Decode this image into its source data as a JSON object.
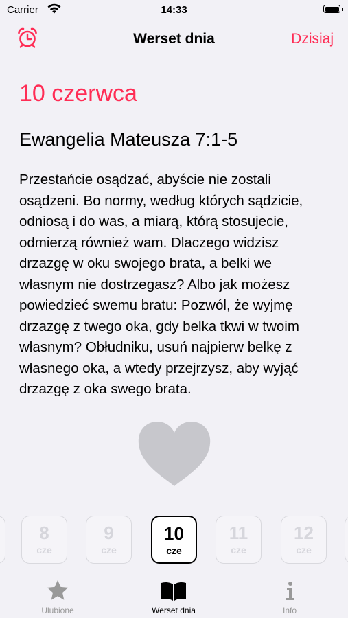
{
  "status_bar": {
    "carrier": "Carrier",
    "time": "14:33"
  },
  "nav": {
    "title": "Werset dnia",
    "today_label": "Dzisiaj",
    "alarm_icon": "alarm-clock-icon"
  },
  "accent_color": "#ff2d55",
  "content": {
    "date": "10 czerwca",
    "reference": "Ewangelia Mateusza 7:1-5",
    "verse_lines": [
      "Przestańcie osądzać, abyście nie zostali",
      "osądzeni. Bo normy, według których sądzicie,",
      "odniosą i do was, a miarą, którą stosujecie,",
      "odmierzą również wam. Dlaczego widzisz",
      "drzazgę w oku swojego brata, a belki we",
      "własnym nie dostrzegasz? Albo jak możesz",
      "powiedzieć swemu bratu: Pozwól, że wyjmę",
      "drzazgę z twego oka, gdy belka tkwi w twoim",
      "własnym? Obłudniku, usuń najpierw belkę z",
      "własnego oka, a wtedy przejrzysz, aby wyjąć",
      "drzazgę z oka swego brata."
    ],
    "favorite_icon": "heart-icon",
    "favorited": false
  },
  "days": [
    {
      "num": "8",
      "month": "cze"
    },
    {
      "num": "9",
      "month": "cze"
    },
    {
      "num": "10",
      "month": "cze"
    },
    {
      "num": "11",
      "month": "cze"
    },
    {
      "num": "12",
      "month": "cze"
    }
  ],
  "selected_day": "10",
  "tabs": [
    {
      "label": "Ulubione",
      "icon": "star-icon"
    },
    {
      "label": "Werset dnia",
      "icon": "book-icon"
    },
    {
      "label": "Info",
      "icon": "info-icon"
    }
  ],
  "active_tab": "Werset dnia"
}
